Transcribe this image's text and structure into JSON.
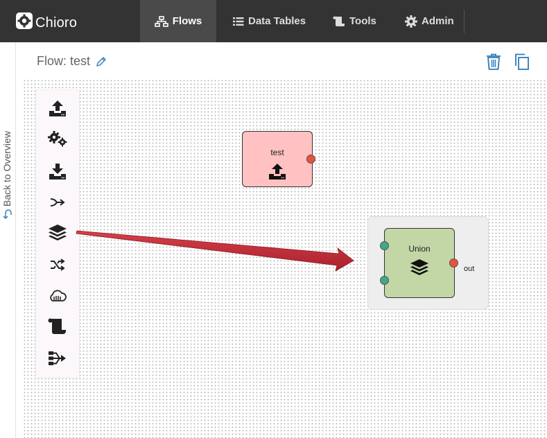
{
  "app": {
    "name": "Chioro"
  },
  "nav": {
    "items": [
      {
        "label": "Flows",
        "icon": "sitemap-icon",
        "active": true
      },
      {
        "label": "Data Tables",
        "icon": "list-icon",
        "active": false
      },
      {
        "label": "Tools",
        "icon": "scroll-icon",
        "active": false
      },
      {
        "label": "Admin",
        "icon": "gear-icon",
        "active": false
      }
    ]
  },
  "sidebar": {
    "back_label": "Back to Overview"
  },
  "header": {
    "flow_title": "Flow: test"
  },
  "palette": {
    "tools": [
      {
        "icon": "upload-icon"
      },
      {
        "icon": "gears-icon"
      },
      {
        "icon": "download-icon"
      },
      {
        "icon": "merge-icon"
      },
      {
        "icon": "layers-icon"
      },
      {
        "icon": "shuffle-icon"
      },
      {
        "icon": "cloud-icon"
      },
      {
        "icon": "scroll-icon"
      },
      {
        "icon": "split-icon"
      }
    ]
  },
  "nodes": [
    {
      "label": "test",
      "icon": "upload-icon",
      "color": "#ffc1c1",
      "ports_out": [
        "out"
      ]
    },
    {
      "label": "Union",
      "icon": "layers-icon",
      "color": "#c2d6a6",
      "ports_in": 2,
      "port_out_label": "out"
    }
  ],
  "colors": {
    "topbar": "#333333",
    "accent_blue": "#2b7bb9",
    "arrow_red": "#c8313b",
    "port_output": "#e9523c",
    "port_input": "#3fa88a"
  }
}
